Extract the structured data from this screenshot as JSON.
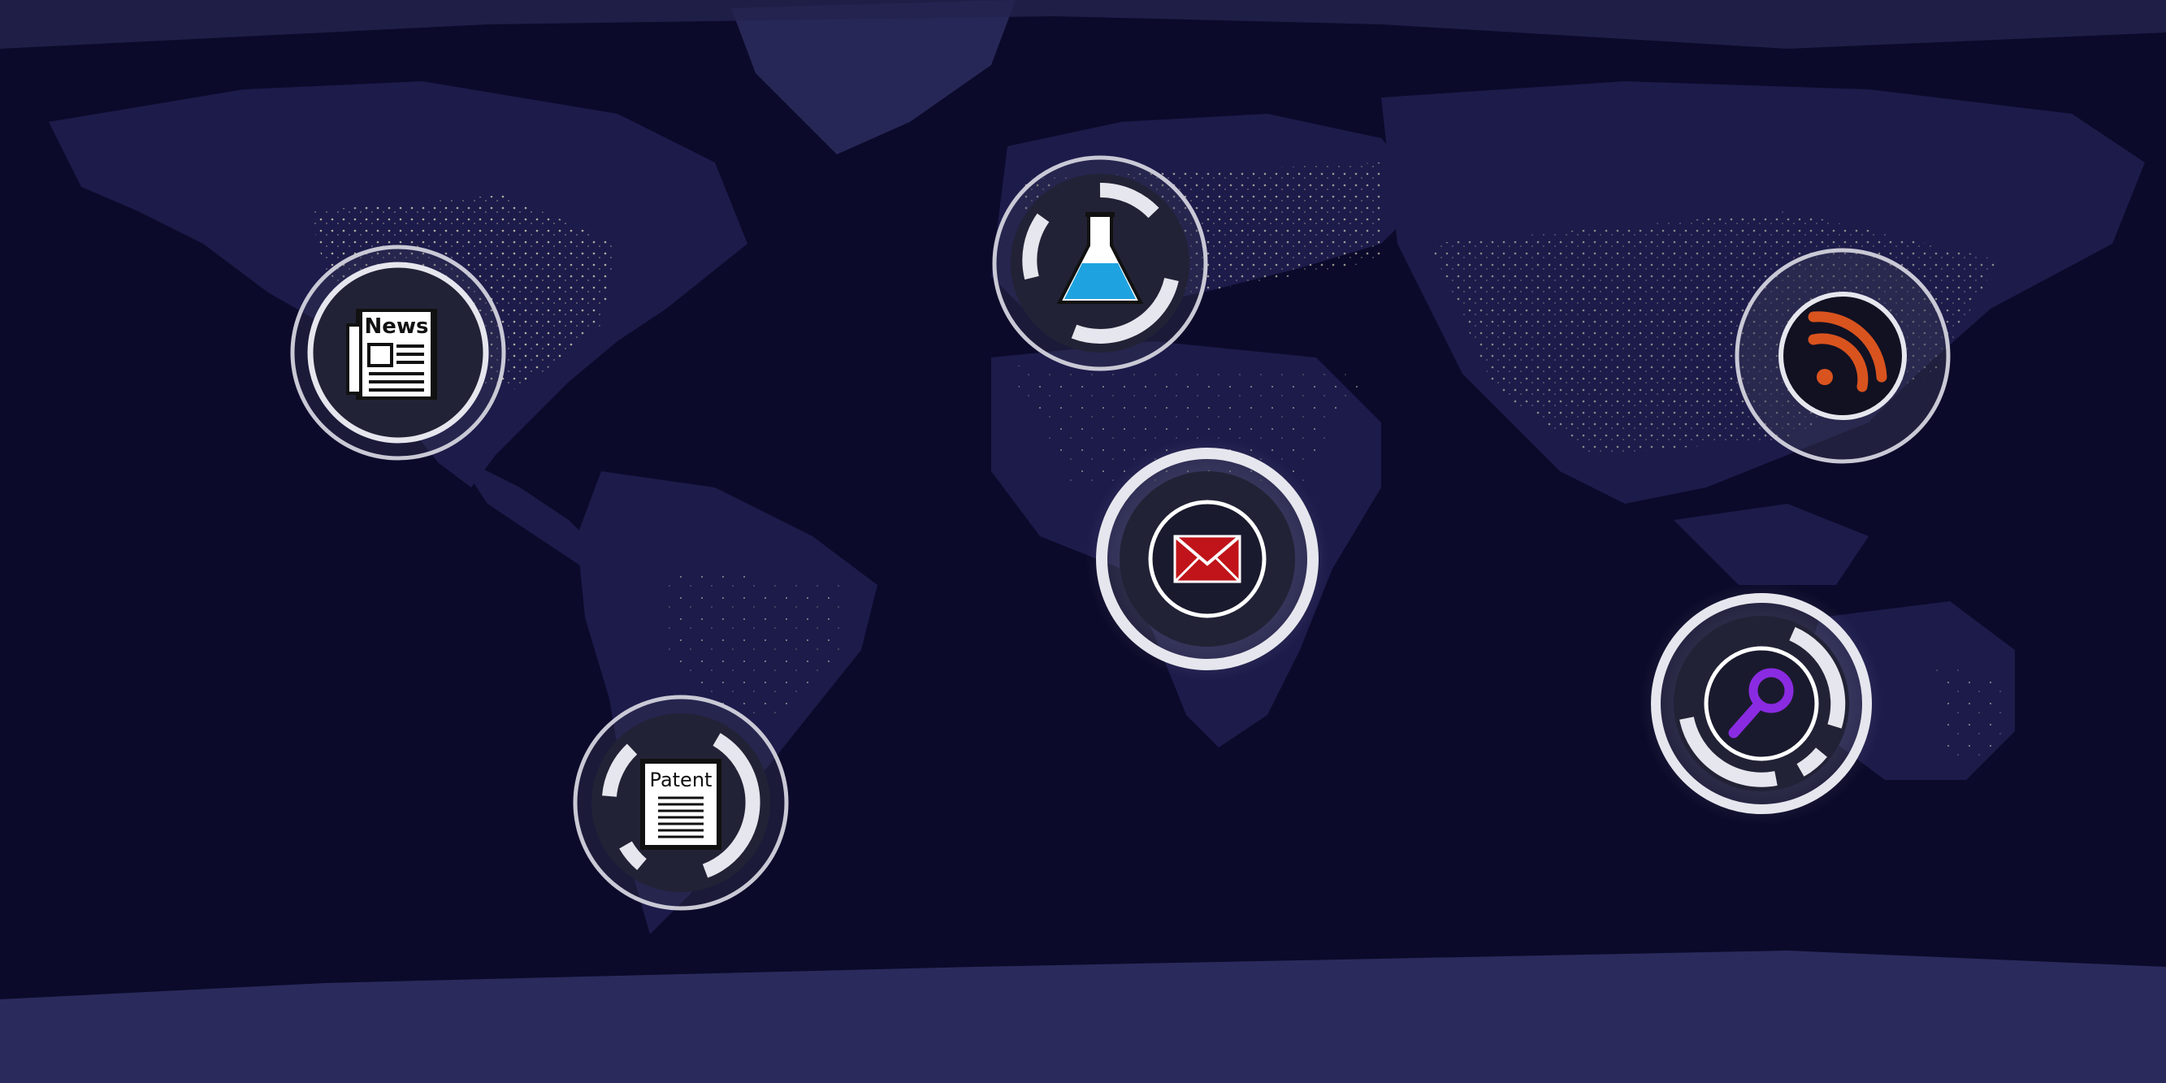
{
  "colors": {
    "ocean": "#0b0a2a",
    "land": "#1d1b4a",
    "ice": "#2a2a5c",
    "city_lights": "#f4f0c8",
    "ring": "#c9c9d6",
    "disc": "#222236",
    "rss_orange": "#d9531e",
    "mail_red": "#c0141a",
    "flask_blue": "#1fa3e0",
    "search_purple": "#8a2be2"
  },
  "nodes": [
    {
      "id": "news",
      "icon": "newspaper-icon",
      "label": "News",
      "state": "idle"
    },
    {
      "id": "science",
      "icon": "flask-icon",
      "label": "",
      "state": "loading",
      "progress": 0.55
    },
    {
      "id": "blogs",
      "icon": "rss-icon",
      "label": "",
      "state": "idle"
    },
    {
      "id": "mail",
      "icon": "envelope-icon",
      "label": "",
      "state": "highlighted"
    },
    {
      "id": "patent",
      "icon": "document-icon",
      "label": "Patent",
      "state": "loading",
      "progress": 0.75
    },
    {
      "id": "search",
      "icon": "magnifier-icon",
      "label": "",
      "state": "loading",
      "progress": 0.65
    }
  ]
}
